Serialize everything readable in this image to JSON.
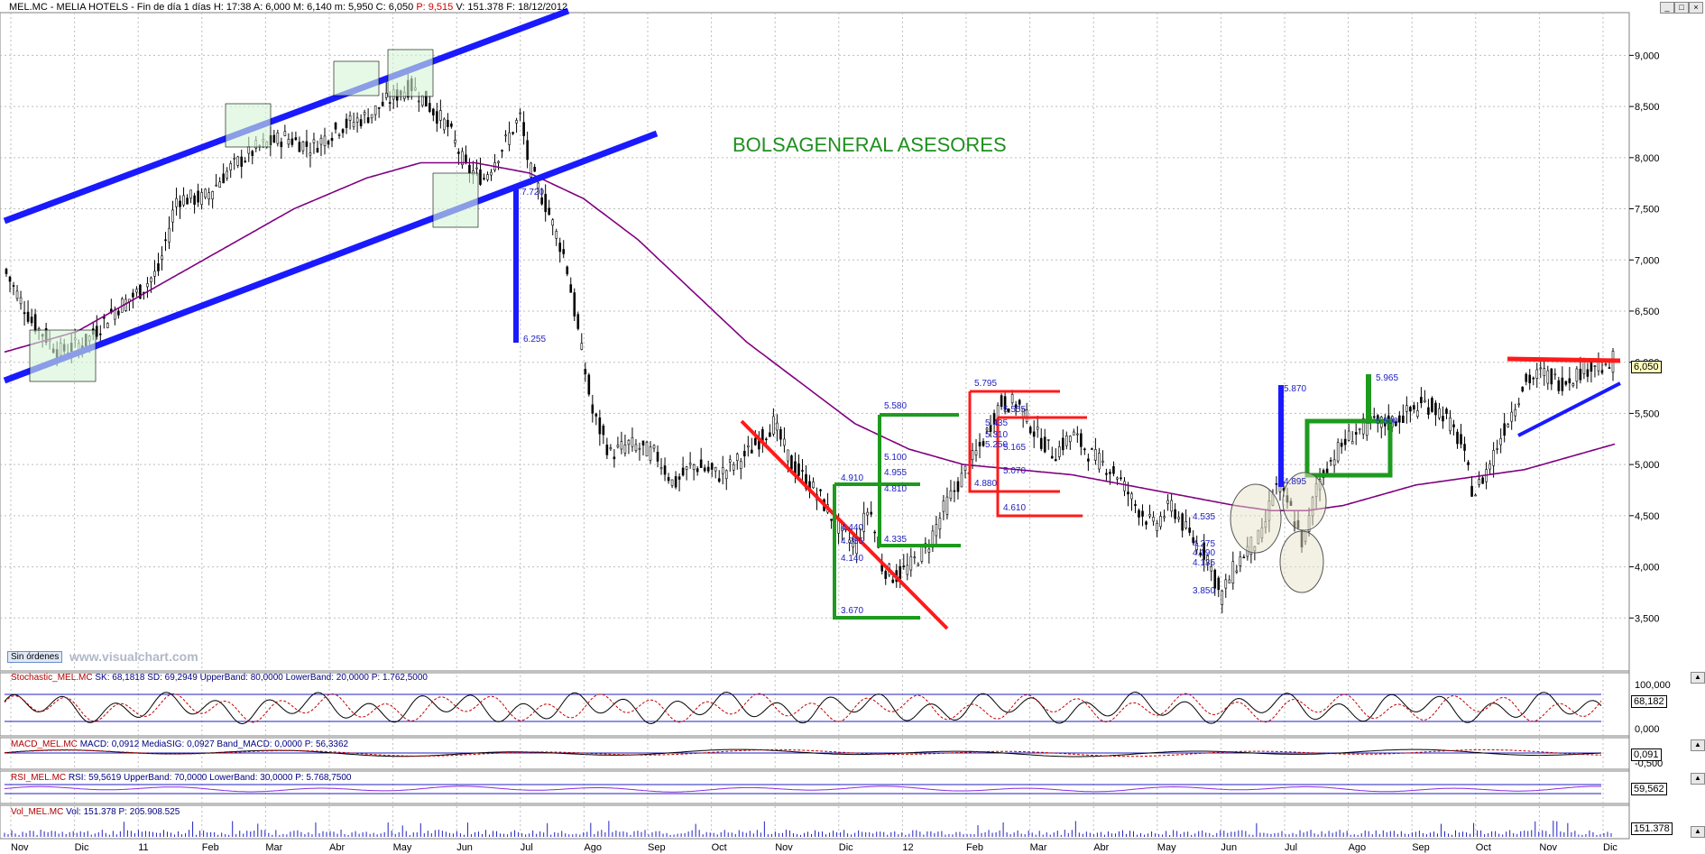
{
  "header": {
    "symbol": "MEL.MC - MELIA HOTELS - Fin de día 1 días",
    "time": "H: 17:38",
    "open": "A: 6,000",
    "high": "M: 6,140",
    "low": "m: 5,950",
    "close": "C: 6,050",
    "period": "P: 9,515",
    "volume": "V: 151.378",
    "date": "F: 18/12/2012"
  },
  "window_buttons": [
    "_",
    "□",
    "×"
  ],
  "brand_text": "BOLSAGENERAL ASESORES",
  "watermark": "www.visualchart.com",
  "orders_button": "Sin órdenes",
  "last_price_label": "6,050",
  "x_months": [
    "Nov",
    "Dic",
    "11",
    "Feb",
    "Mar",
    "Abr",
    "May",
    "Jun",
    "Jul",
    "Ago",
    "Sep",
    "Oct",
    "Nov",
    "Dic",
    "12",
    "Feb",
    "Mar",
    "Abr",
    "May",
    "Jun",
    "Jul",
    "Ago",
    "Sep",
    "Oct",
    "Nov",
    "Dic"
  ],
  "price_axis_labels": [
    "9,000",
    "8,500",
    "8,000",
    "7,500",
    "7,000",
    "6,500",
    "6,000",
    "5,500",
    "5,000",
    "4,500",
    "4,000",
    "3,500"
  ],
  "annotations": [
    "7.720",
    "6.255",
    "5.580",
    "5.100",
    "4.955",
    "4.810",
    "4.910",
    "4.440",
    "4.285",
    "4.140",
    "4.335",
    "3.670",
    "5.795",
    "5.555",
    "5.435",
    "5.310",
    "5.250",
    "5.165",
    "5.070",
    "4.880",
    "4.610",
    "5.870",
    "4.895",
    "5.965",
    "5.500",
    "4.535",
    "4.275",
    "4.190",
    "4.135",
    "3.850"
  ],
  "stochastic": {
    "title_name": "Stochastic_MEL.MC",
    "title_values": "SK: 68,1818  SD: 69,2949  UpperBand: 80,0000  LowerBand: 20,0000  P: 1.762,5000",
    "axis": [
      "100,000",
      "68,182",
      "0,000"
    ]
  },
  "macd": {
    "title_name": "MACD_MEL.MC",
    "title_values": "MACD: 0,0912  MediaSIG: 0,0927  Band_MACD: 0,0000  P: 56,3362",
    "axis": [
      "0,091",
      "-0,500"
    ]
  },
  "rsi": {
    "title_name": "RSI_MEL.MC",
    "title_values": "RSI: 59,5619  UpperBand: 70,0000  LowerBand: 30,0000  P: 5.768,7500",
    "axis": [
      "59,562"
    ]
  },
  "vol": {
    "title_name": "Vol_MEL.MC",
    "title_values": "Vol: 151.378  P: 205.908.525",
    "axis": [
      "151.378"
    ]
  },
  "colors": {
    "candles": "#000000",
    "ma": "#800080",
    "trend_blue": "#1a1aff",
    "trend_red": "#ff1a1a",
    "box_green": "#1e9a1e",
    "grid": "#bdbdbd"
  },
  "chart_data": {
    "type": "candlestick",
    "title": "MEL.MC - MELIA HOTELS",
    "x_start": "Nov 2010",
    "x_end": "Dic 2012",
    "ylim": [
      3.0,
      9.4
    ],
    "close_anchors": [
      [
        0,
        6.9
      ],
      [
        15,
        6.4
      ],
      [
        30,
        6.1
      ],
      [
        45,
        6.2
      ],
      [
        60,
        6.5
      ],
      [
        75,
        6.7
      ],
      [
        85,
        6.9
      ],
      [
        95,
        7.6
      ],
      [
        110,
        7.6
      ],
      [
        125,
        7.9
      ],
      [
        140,
        8.1
      ],
      [
        155,
        8.2
      ],
      [
        170,
        8.1
      ],
      [
        185,
        8.3
      ],
      [
        200,
        8.4
      ],
      [
        215,
        8.6
      ],
      [
        225,
        8.7
      ],
      [
        235,
        8.5
      ],
      [
        245,
        8.3
      ],
      [
        255,
        7.9
      ],
      [
        265,
        7.8
      ],
      [
        275,
        8.1
      ],
      [
        285,
        8.4
      ],
      [
        290,
        7.9
      ],
      [
        300,
        7.5
      ],
      [
        310,
        7.0
      ],
      [
        318,
        6.2
      ],
      [
        325,
        5.5
      ],
      [
        335,
        5.1
      ],
      [
        345,
        5.2
      ],
      [
        360,
        5.1
      ],
      [
        370,
        4.8
      ],
      [
        380,
        5.0
      ],
      [
        395,
        4.9
      ],
      [
        410,
        5.1
      ],
      [
        425,
        5.4
      ],
      [
        435,
        5.0
      ],
      [
        450,
        4.7
      ],
      [
        460,
        4.4
      ],
      [
        470,
        4.2
      ],
      [
        478,
        4.6
      ],
      [
        485,
        4.0
      ],
      [
        492,
        3.9
      ],
      [
        500,
        4.0
      ],
      [
        510,
        4.2
      ],
      [
        520,
        4.6
      ],
      [
        530,
        4.9
      ],
      [
        540,
        5.2
      ],
      [
        550,
        5.6
      ],
      [
        560,
        5.6
      ],
      [
        570,
        5.3
      ],
      [
        580,
        5.1
      ],
      [
        590,
        5.3
      ],
      [
        600,
        5.1
      ],
      [
        615,
        4.9
      ],
      [
        625,
        4.6
      ],
      [
        635,
        4.4
      ],
      [
        645,
        4.6
      ],
      [
        655,
        4.3
      ],
      [
        665,
        4.1
      ],
      [
        672,
        3.7
      ],
      [
        680,
        4.0
      ],
      [
        688,
        4.2
      ],
      [
        695,
        4.3
      ],
      [
        702,
        4.8
      ],
      [
        710,
        4.6
      ],
      [
        718,
        4.2
      ],
      [
        725,
        4.8
      ],
      [
        735,
        5.1
      ],
      [
        745,
        5.3
      ],
      [
        755,
        5.4
      ],
      [
        765,
        5.4
      ],
      [
        775,
        5.5
      ],
      [
        785,
        5.6
      ],
      [
        795,
        5.5
      ],
      [
        805,
        5.2
      ],
      [
        812,
        4.7
      ],
      [
        818,
        4.9
      ],
      [
        830,
        5.4
      ],
      [
        840,
        5.8
      ],
      [
        850,
        5.9
      ],
      [
        860,
        5.8
      ],
      [
        870,
        5.9
      ],
      [
        880,
        6.0
      ],
      [
        885,
        5.9
      ],
      [
        890,
        6.05
      ]
    ],
    "ma_anchors": [
      [
        0,
        6.1
      ],
      [
        40,
        6.3
      ],
      [
        80,
        6.7
      ],
      [
        120,
        7.1
      ],
      [
        160,
        7.5
      ],
      [
        200,
        7.8
      ],
      [
        230,
        7.95
      ],
      [
        260,
        7.95
      ],
      [
        290,
        7.85
      ],
      [
        320,
        7.6
      ],
      [
        350,
        7.2
      ],
      [
        380,
        6.7
      ],
      [
        410,
        6.2
      ],
      [
        440,
        5.8
      ],
      [
        470,
        5.4
      ],
      [
        500,
        5.15
      ],
      [
        530,
        5.0
      ],
      [
        560,
        4.95
      ],
      [
        590,
        4.9
      ],
      [
        620,
        4.8
      ],
      [
        650,
        4.7
      ],
      [
        680,
        4.6
      ],
      [
        700,
        4.55
      ],
      [
        720,
        4.55
      ],
      [
        740,
        4.6
      ],
      [
        760,
        4.7
      ],
      [
        780,
        4.8
      ],
      [
        800,
        4.85
      ],
      [
        820,
        4.9
      ],
      [
        840,
        4.95
      ],
      [
        860,
        5.05
      ],
      [
        880,
        5.15
      ],
      [
        890,
        5.2
      ]
    ],
    "total_bars": 890,
    "last_close": 6.05,
    "indicators": {
      "stochastic": {
        "sk": 68.1818,
        "sd": 69.2949,
        "upper": 80,
        "lower": 20
      },
      "macd": {
        "macd": 0.0912,
        "signal": 0.0927,
        "band": 0
      },
      "rsi": {
        "rsi": 59.5619,
        "upper": 70,
        "lower": 30
      },
      "volume": {
        "last": 151378
      }
    }
  }
}
